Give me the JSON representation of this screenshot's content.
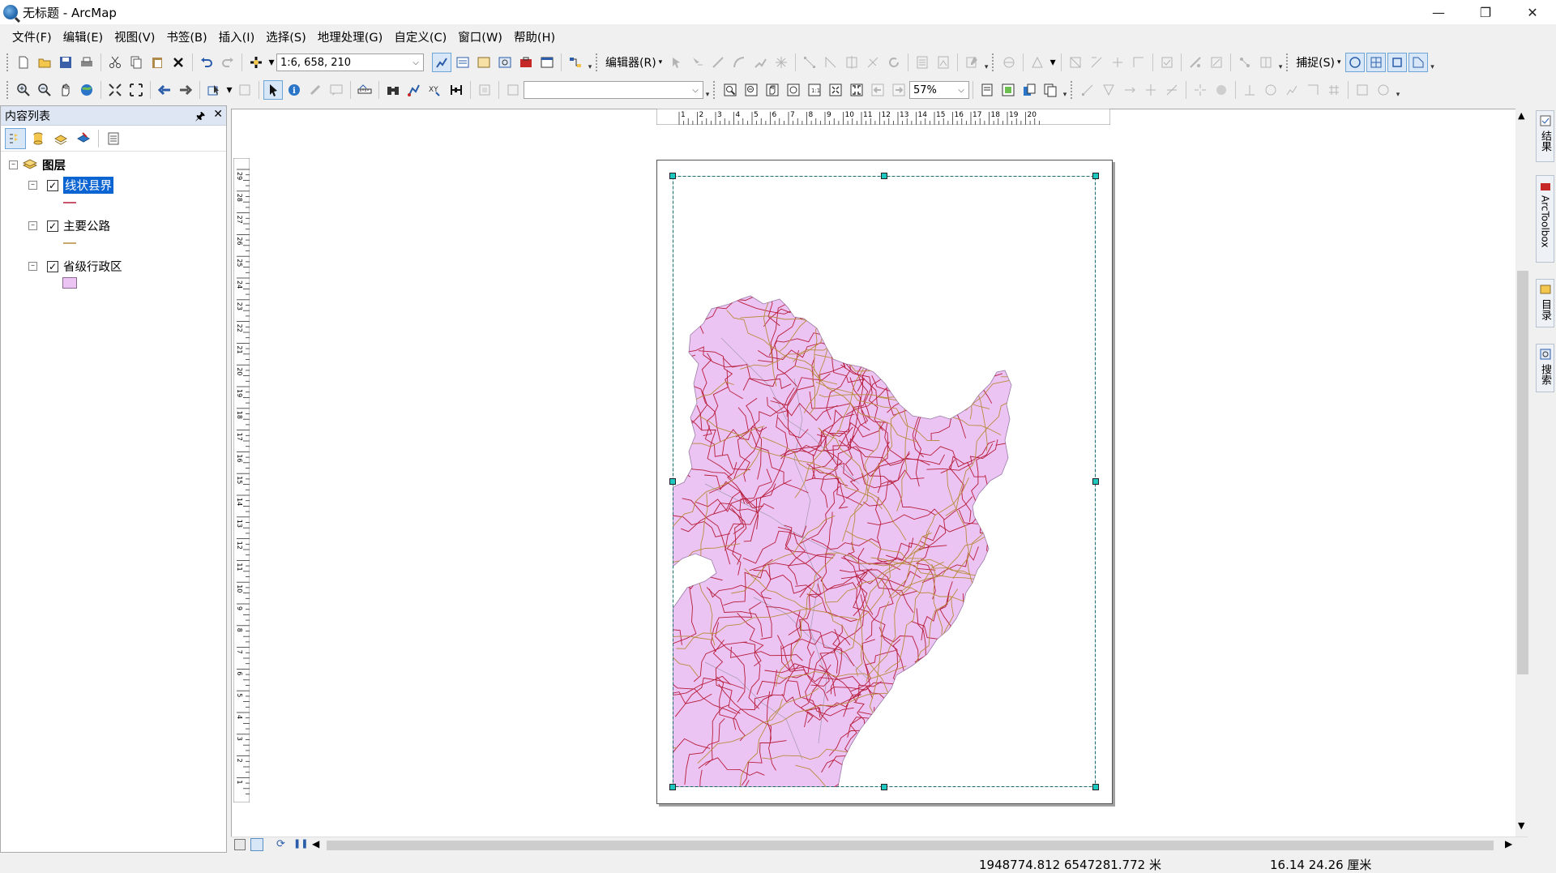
{
  "window": {
    "title": "无标题 - ArcMap"
  },
  "menu": [
    "文件(F)",
    "编辑(E)",
    "视图(V)",
    "书签(B)",
    "插入(I)",
    "选择(S)",
    "地理处理(G)",
    "自定义(C)",
    "窗口(W)",
    "帮助(H)"
  ],
  "toolbar": {
    "scale_value": "1:6, 658, 210",
    "editor_label": "编辑器(R)",
    "snapping_label": "捕捉(S)",
    "zoom_percent": "57%"
  },
  "toc": {
    "title": "内容列表",
    "root_label": "图层",
    "layers": [
      {
        "label": "线状县界",
        "checked": true,
        "selected": true,
        "symbol": "line",
        "color": "#b71c3a"
      },
      {
        "label": "主要公路",
        "checked": true,
        "selected": false,
        "symbol": "line",
        "color": "#b98b3e"
      },
      {
        "label": "省级行政区",
        "checked": true,
        "selected": false,
        "symbol": "fill",
        "color": "#ecc4f3"
      }
    ]
  },
  "rulers": {
    "horizontal": [
      "1",
      "2",
      "3",
      "4",
      "5",
      "6",
      "7",
      "8",
      "9",
      "10",
      "11",
      "12",
      "13",
      "14",
      "15",
      "16",
      "17",
      "18",
      "19",
      "20"
    ],
    "vertical": [
      "29",
      "28",
      "27",
      "26",
      "25",
      "24",
      "23",
      "22",
      "21",
      "20",
      "19",
      "18",
      "17",
      "16",
      "15",
      "14",
      "13",
      "12",
      "11",
      "10",
      "9",
      "8",
      "7",
      "6",
      "5",
      "4",
      "3",
      "2",
      "1"
    ]
  },
  "right_dock": [
    "结果",
    "ArcToolbox",
    "目录",
    "搜索"
  ],
  "status": {
    "coordinates": "1948774.812  6547281.772 米",
    "page_position": "16.14  24.26 厘米"
  },
  "colors": {
    "province_fill": "#ecc4f3",
    "county_boundary": "#b71c3a",
    "roads": "#b98b3e",
    "selection": "#0a64d2",
    "handle": "#1ec7c0"
  }
}
